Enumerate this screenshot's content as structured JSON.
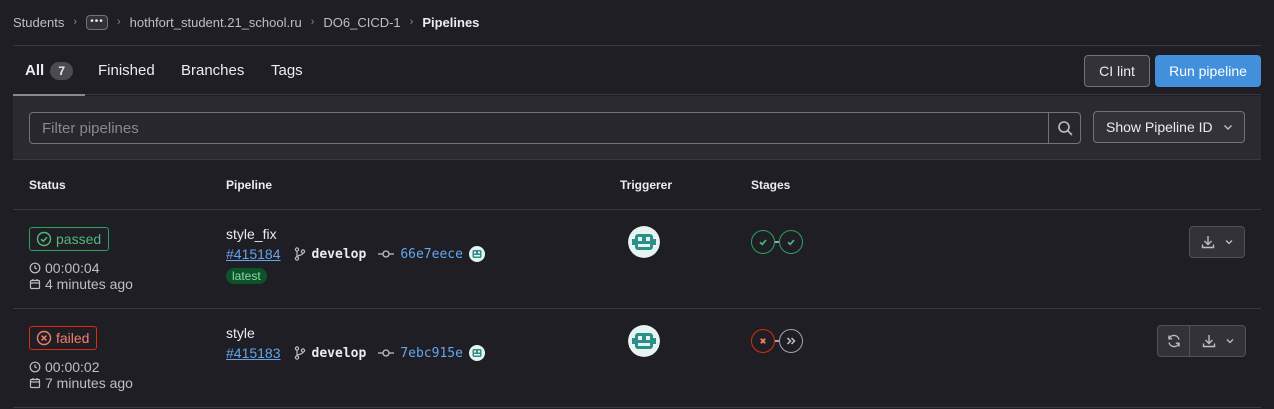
{
  "breadcrumb": {
    "students": "Students",
    "ellipsis": "•••",
    "user": "hothfort_student.21_school.ru",
    "project": "DO6_CICD-1",
    "current": "Pipelines"
  },
  "tabs": [
    {
      "label": "All",
      "count": "7",
      "active": true
    },
    {
      "label": "Finished"
    },
    {
      "label": "Branches"
    },
    {
      "label": "Tags"
    }
  ],
  "actions": {
    "ci_lint": "CI lint",
    "run_pipeline": "Run pipeline"
  },
  "filter": {
    "placeholder": "Filter pipelines",
    "show_id": "Show Pipeline ID"
  },
  "table": {
    "headers": {
      "status": "Status",
      "pipeline": "Pipeline",
      "triggerer": "Triggerer",
      "stages": "Stages"
    }
  },
  "pipelines": [
    {
      "status": "passed",
      "duration": "00:00:04",
      "time_ago": "4 minutes ago",
      "name": "style_fix",
      "id": "#415184",
      "branch": "develop",
      "sha": "66e7eece",
      "tag": "latest",
      "stages": [
        "success",
        "success"
      ]
    },
    {
      "status": "failed",
      "duration": "00:00:02",
      "time_ago": "7 minutes ago",
      "name": "style",
      "id": "#415183",
      "branch": "develop",
      "sha": "7ebc915e",
      "stages": [
        "failed",
        "skipped"
      ]
    }
  ],
  "colors": {
    "background": "#1f1e24",
    "accent": "#428fdc",
    "success": "#2da160",
    "danger": "#dd2b0e",
    "link": "#63a6e9"
  },
  "icons": [
    "ellipsis-icon",
    "search-icon",
    "chevron-down-icon",
    "check-circle-icon",
    "x-circle-icon",
    "clock-icon",
    "calendar-icon",
    "branch-icon",
    "commit-icon",
    "avatar-icon",
    "download-icon",
    "retry-icon",
    "skip-icon"
  ]
}
